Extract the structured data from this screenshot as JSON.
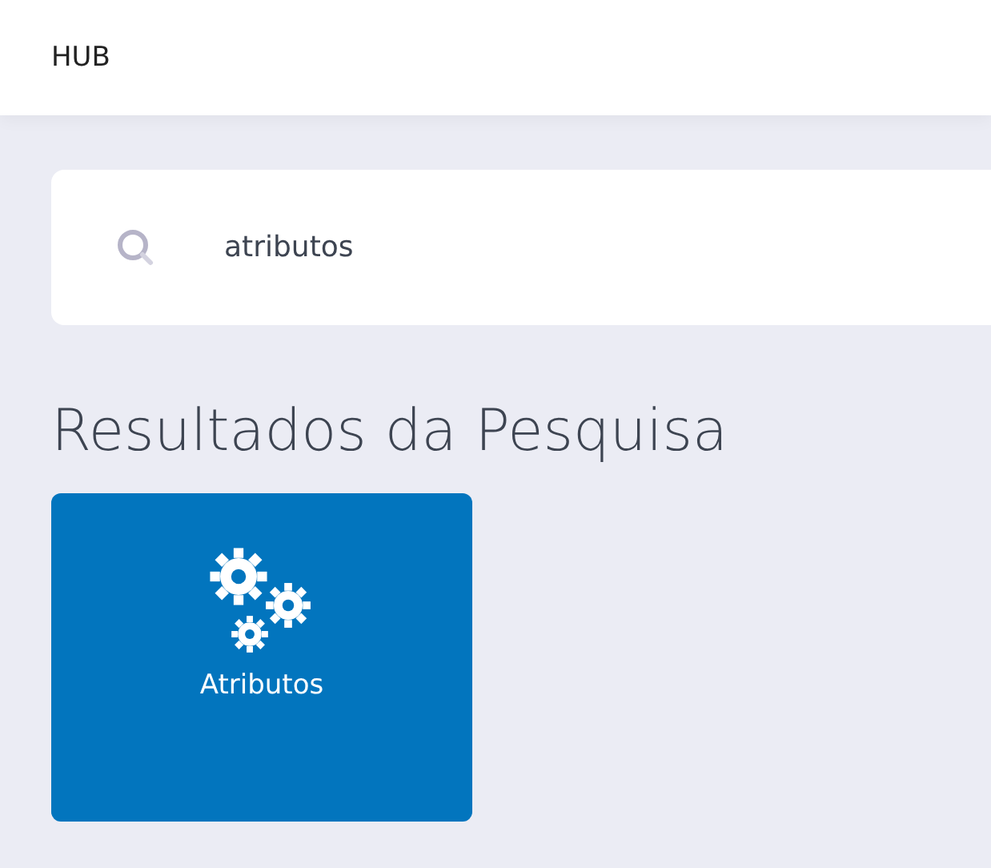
{
  "header": {
    "title": "HUB"
  },
  "search": {
    "value": "atributos"
  },
  "results": {
    "heading": "Resultados da Pesquisa",
    "tiles": [
      {
        "label": "Atributos",
        "kind": "gears"
      }
    ]
  }
}
